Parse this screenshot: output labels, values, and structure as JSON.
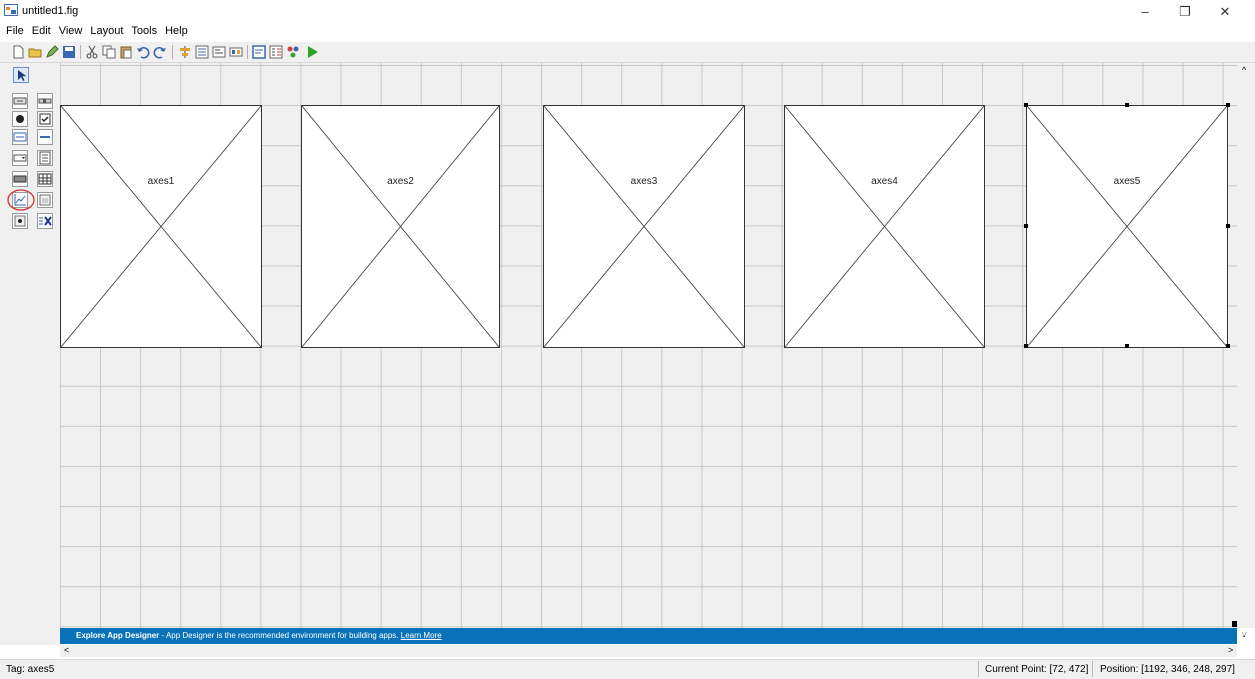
{
  "window": {
    "title": "untitled1.fig",
    "min_label": "–",
    "restore_label": "❐",
    "close_label": "✕"
  },
  "menu": [
    "File",
    "Edit",
    "View",
    "Layout",
    "Tools",
    "Help"
  ],
  "axes": [
    {
      "label": "axes1",
      "selected": false
    },
    {
      "label": "axes2",
      "selected": false
    },
    {
      "label": "axes3",
      "selected": false
    },
    {
      "label": "axes4",
      "selected": false
    },
    {
      "label": "axes5",
      "selected": true
    }
  ],
  "banner": {
    "bold": "Explore App Designer",
    "text": " - App Designer is the recommended environment for building apps. ",
    "link": "Learn More",
    "close_icon": "⊞"
  },
  "scroll": {
    "up": "^",
    "down": "v",
    "left": "<",
    "right": ">"
  },
  "status": {
    "tag": "Tag: axes5",
    "current_point": "Current Point:  [72, 472]",
    "position": "Position: [1192, 346, 248, 297]"
  },
  "palette_icons": [
    "select-arrow-icon",
    "push-button-icon",
    "slider-icon",
    "radio-button-icon",
    "checkbox-icon",
    "edit-text-icon",
    "static-text-icon",
    "popup-menu-icon",
    "listbox-icon",
    "toggle-button-icon",
    "table-icon",
    "axes-icon",
    "panel-icon",
    "button-group-icon",
    "activex-icon"
  ],
  "colors": {
    "banner": "#0a72b8",
    "grid": "#c8c8c8",
    "canvas": "#f0f0f0"
  }
}
